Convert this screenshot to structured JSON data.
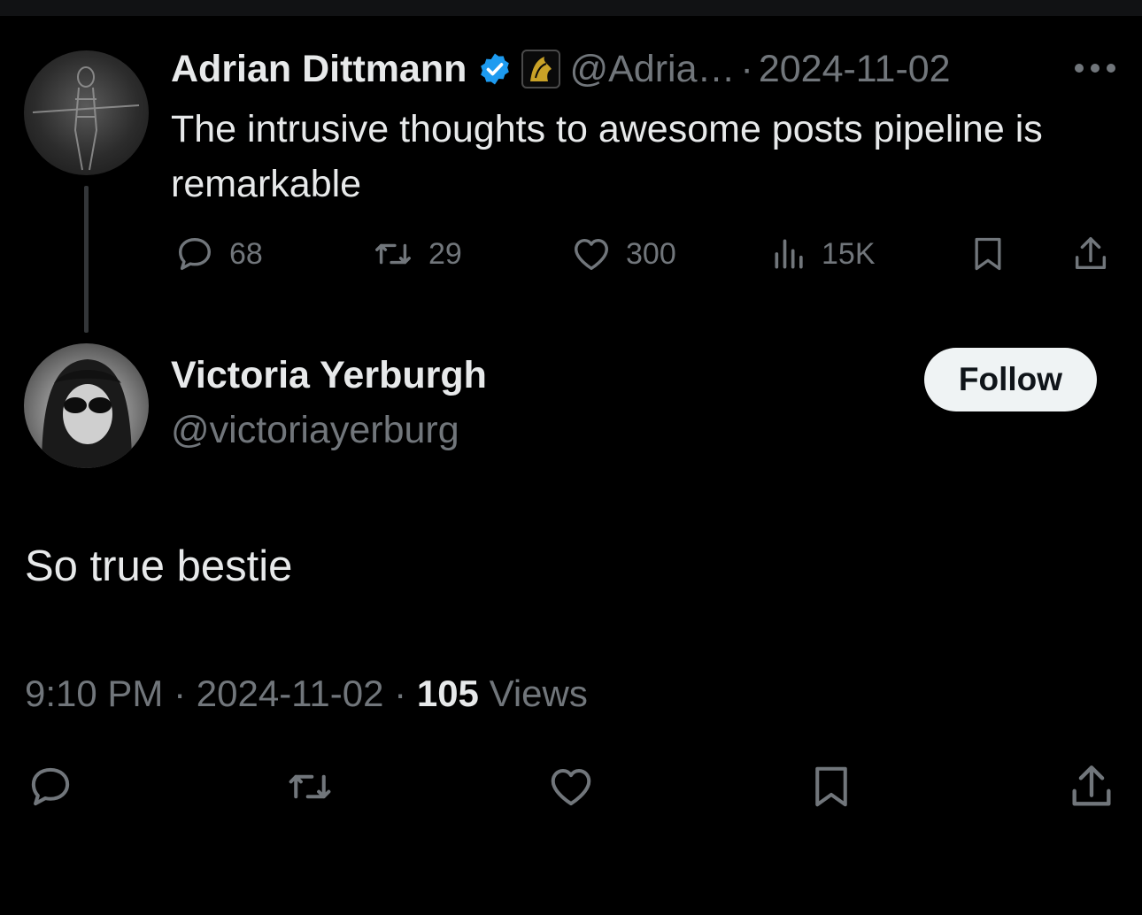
{
  "parent_tweet": {
    "display_name": "Adrian Dittmann",
    "handle": "@Adria…",
    "separator": "·",
    "date": "2024-11-02",
    "text": "The intrusive thoughts to awesome posts pipeline is remarkable",
    "stats": {
      "replies": "68",
      "reposts": "29",
      "likes": "300",
      "views": "15K"
    }
  },
  "reply_tweet": {
    "display_name": "Victoria Yerburgh",
    "handle": "@victoriayerburg",
    "follow_label": "Follow",
    "text": "So true bestie",
    "time": "9:10 PM",
    "separator": "·",
    "date": "2024-11-02",
    "views_count": "105",
    "views_label": "Views"
  },
  "icons": {
    "verified": "verified-badge-icon",
    "affiliate": "lion-affiliate-icon",
    "more": "more-dots-icon",
    "reply": "reply-icon",
    "repost": "repost-icon",
    "like": "heart-icon",
    "views": "views-chart-icon",
    "bookmark": "bookmark-icon",
    "share": "share-icon"
  },
  "colors": {
    "background": "#000000",
    "text": "#e7e9ea",
    "muted": "#71767b",
    "verified": "#1d9bf0",
    "follow_bg": "#eff3f4",
    "thread_line": "#333639"
  }
}
